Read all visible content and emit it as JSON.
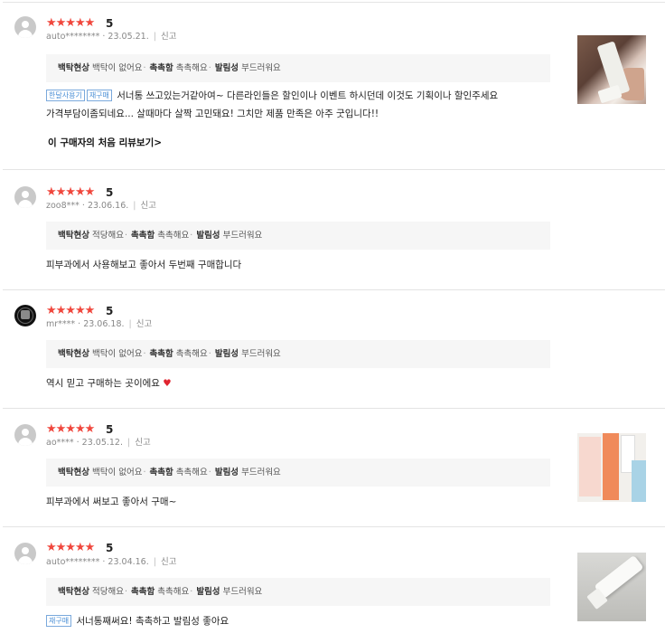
{
  "reviews": [
    {
      "stars": "★★★★★",
      "score": "5",
      "user": "auto********",
      "date": "23.05.21.",
      "report": "신고",
      "eval": [
        {
          "key": "백탁현상",
          "value": "백탁이 없어요"
        },
        {
          "key": "촉촉함",
          "value": "촉촉해요"
        },
        {
          "key": "발림성",
          "value": "부드러워요"
        }
      ],
      "badges": [
        "한달사용기",
        "재구매"
      ],
      "text_line1": "서너통 쓰고있는거같아여~ 다른라인들은 할인이나 이벤트 하시던데 이것도 기획이나 할인주세요",
      "text_line2": "가격부담이좀되네요... 살때마다 살짝 고민돼요! 그치만 제품 만족은 아주 굿입니다!!",
      "first_review_link": "이 구매자의 처음 리뷰보기"
    },
    {
      "stars": "★★★★★",
      "score": "5",
      "user": "zoo8***",
      "date": "23.06.16.",
      "report": "신고",
      "eval": [
        {
          "key": "백탁현상",
          "value": "적당해요"
        },
        {
          "key": "촉촉함",
          "value": "촉촉해요"
        },
        {
          "key": "발림성",
          "value": "부드러워요"
        }
      ],
      "text": "피부과에서 사용해보고 좋아서 두번째 구매합니다"
    },
    {
      "stars": "★★★★★",
      "score": "5",
      "user": "mr****",
      "date": "23.06.18.",
      "report": "신고",
      "eval": [
        {
          "key": "백탁현상",
          "value": "백탁이 없어요"
        },
        {
          "key": "촉촉함",
          "value": "촉촉해요"
        },
        {
          "key": "발림성",
          "value": "부드러워요"
        }
      ],
      "text": "역시 믿고 구매하는 곳이에요",
      "emoji": "♥"
    },
    {
      "stars": "★★★★★",
      "score": "5",
      "user": "ao****",
      "date": "23.05.12.",
      "report": "신고",
      "eval": [
        {
          "key": "백탁현상",
          "value": "백탁이 없어요"
        },
        {
          "key": "촉촉함",
          "value": "촉촉해요"
        },
        {
          "key": "발림성",
          "value": "부드러워요"
        }
      ],
      "text": "피부과에서 써보고 좋아서 구매~"
    },
    {
      "stars": "★★★★★",
      "score": "5",
      "user": "auto********",
      "date": "23.04.16.",
      "report": "신고",
      "eval": [
        {
          "key": "백탁현상",
          "value": "적당해요"
        },
        {
          "key": "촉촉함",
          "value": "촉촉해요"
        },
        {
          "key": "발림성",
          "value": "부드러워요"
        }
      ],
      "badges": [
        "재구매"
      ],
      "text": "서너통째써요! 촉촉하고 발림성 좋아요"
    }
  ],
  "colors": {
    "star": "#f0473d",
    "badge": "#4a8fd6",
    "eval_bg": "#f6f6f6"
  }
}
